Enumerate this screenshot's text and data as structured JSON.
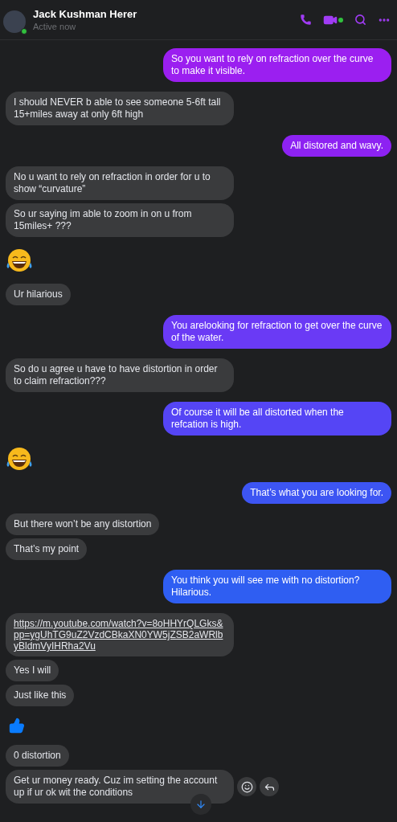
{
  "header": {
    "name": "Jack Kushman Herer",
    "status": "Active now",
    "online": true,
    "video_online": true
  },
  "messages": [
    {
      "outgoing": true,
      "kind": "text",
      "text": "So you want to rely on refraction over the curve to make it visible.",
      "color": "#9b1ff0"
    },
    {
      "outgoing": false,
      "kind": "text",
      "text": "I should NEVER b able to see someone 5-6ft tall 15+miles away at only 6ft high"
    },
    {
      "outgoing": true,
      "kind": "text",
      "text": "All distored and wavy.",
      "color": "#8d22f2"
    },
    {
      "outgoing": false,
      "kind": "text",
      "text": "No u want to rely on refraction in order for u to show “curvature”"
    },
    {
      "outgoing": false,
      "kind": "text",
      "text": "So ur saying im able to zoom in on u from 15miles+ ???"
    },
    {
      "kind": "laugh"
    },
    {
      "outgoing": false,
      "kind": "text",
      "text": "Ur hilarious"
    },
    {
      "outgoing": true,
      "kind": "text",
      "text": "You arelooking for refraction to get over the curve of the water.",
      "color": "#6a3af5"
    },
    {
      "outgoing": false,
      "kind": "text",
      "text": "So do u agree u have to have distortion in order to claim refraction???"
    },
    {
      "outgoing": true,
      "kind": "text",
      "text": "Of course it will be all distorted when the refcation is high.",
      "color": "#5545f5"
    },
    {
      "kind": "laugh"
    },
    {
      "outgoing": true,
      "kind": "text",
      "text": "That’s what you are looking for.",
      "color": "#3d55f3"
    },
    {
      "outgoing": false,
      "kind": "text",
      "text": "But there won’t be any distortion"
    },
    {
      "outgoing": false,
      "kind": "text",
      "text": "That’s my point"
    },
    {
      "outgoing": true,
      "kind": "text",
      "text": "You think you will see me with no distortion? Hilarious.",
      "color": "#2f5ef2"
    },
    {
      "outgoing": false,
      "kind": "link",
      "text": "https://m.youtube.com/watch?v=8oHHYrQLGks&pp=ygUhTG9uZ2VzdCBkaXN0YW5jZSB2aWRlbyBldmVyIHRha2Vu"
    },
    {
      "outgoing": false,
      "kind": "text",
      "text": "Yes I will"
    },
    {
      "outgoing": false,
      "kind": "text",
      "text": "Just like this"
    },
    {
      "kind": "like"
    },
    {
      "outgoing": false,
      "kind": "text",
      "text": "0 distortion"
    },
    {
      "outgoing": false,
      "kind": "text",
      "text": "Get ur money ready. Cuz im setting the account up if ur ok wit the conditions",
      "hovered": true
    }
  ]
}
